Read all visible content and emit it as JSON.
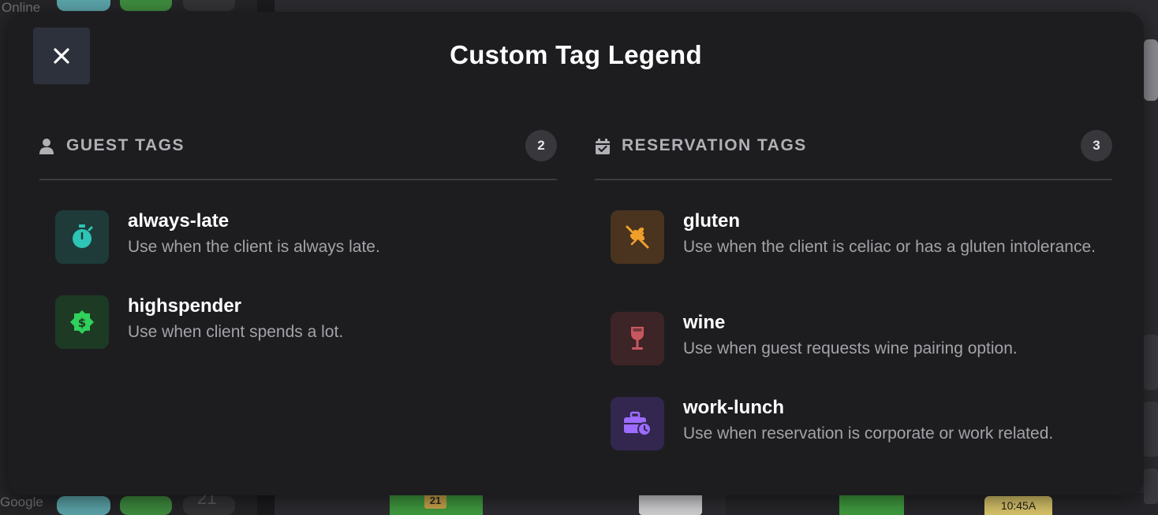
{
  "background": {
    "left_top_label": "Online",
    "left_bottom_label": "Google",
    "bottom_left_number": "21",
    "bottom_chip_number": "21",
    "bottom_time_chip": "10:45A"
  },
  "modal": {
    "title": "Custom Tag Legend",
    "close_icon": "close-icon",
    "guest_section": {
      "icon": "person-icon",
      "label": "GUEST TAGS",
      "count": "2",
      "tags": [
        {
          "name": "always-late",
          "description": "Use when the client is always late.",
          "icon": "stopwatch-icon",
          "icon_color": "#2ec4b6",
          "bg_color": "#1e3b3a"
        },
        {
          "name": "highspender",
          "description": "Use when client spends a lot.",
          "icon": "dollar-badge-icon",
          "icon_color": "#2fd15a",
          "bg_color": "#1d3a24"
        }
      ]
    },
    "reservation_section": {
      "icon": "calendar-check-icon",
      "label": "RESERVATION TAGS",
      "count": "3",
      "tags": [
        {
          "name": "gluten",
          "description": "Use when the client is celiac or has a gluten intolerance.",
          "icon": "no-gluten-icon",
          "icon_color": "#f0a02a",
          "bg_color": "#4a3420"
        },
        {
          "name": "wine",
          "description": "Use when guest requests wine pairing option.",
          "icon": "wine-glass-icon",
          "icon_color": "#c7575f",
          "bg_color": "#3d2426"
        },
        {
          "name": "work-lunch",
          "description": "Use when reservation is corporate or work related.",
          "icon": "briefcase-clock-icon",
          "icon_color": "#9b6cff",
          "bg_color": "#33264f"
        }
      ]
    }
  }
}
